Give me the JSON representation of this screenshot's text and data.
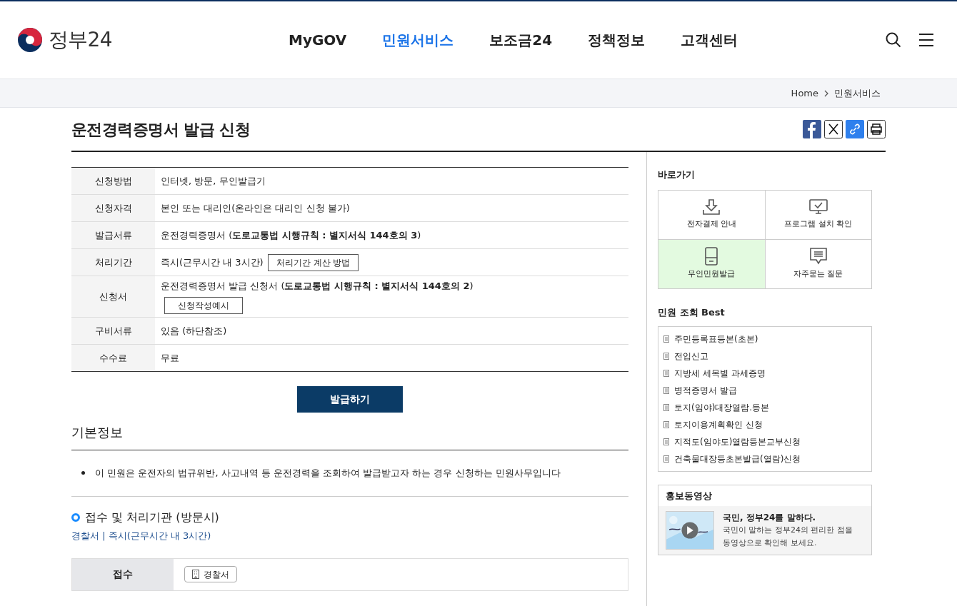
{
  "header": {
    "logo_text": "정부24",
    "nav": [
      {
        "label": "MyGOV",
        "selected": false
      },
      {
        "label": "민원서비스",
        "selected": true
      },
      {
        "label": "보조금24",
        "selected": false
      },
      {
        "label": "정책정보",
        "selected": false
      },
      {
        "label": "고객센터",
        "selected": false
      }
    ]
  },
  "breadcrumb": [
    "Home",
    "민원서비스"
  ],
  "page_title": "운전경력증명서 발급 신청",
  "info_table": [
    {
      "label": "신청방법",
      "value": "인터넷, 방문, 무인발급기"
    },
    {
      "label": "신청자격",
      "value": "본인 또는 대리인(온라인은 대리인 신청 불가)"
    },
    {
      "label": "발급서류",
      "value": "운전경력증명서 (**도로교통법 시행규칙 : 별지서식 144호의 3**)"
    },
    {
      "label": "처리기간",
      "value": "즉시(근무시간 내 3시간)",
      "button": "처리기간 계산 방법",
      "button_below": false
    },
    {
      "label": "신청서",
      "value": "운전경력증명서 발급 신청서 (**도로교통법 시행규칙 : 별지서식 144호의 2**)",
      "button": "신청작성예시",
      "button_below": true
    },
    {
      "label": "구비서류",
      "value": "있음 (하단참조)"
    },
    {
      "label": "수수료",
      "value": "무료"
    }
  ],
  "apply_button": "발급하기",
  "basic_info": {
    "title": "기본정보",
    "bullets": [
      "이 민원은 운전자의 법규위반, 사고내역 등 운전경력을 조회하여 발급받고자 하는 경우 신청하는 민원사무입니다"
    ]
  },
  "agency": {
    "title": "접수 및 처리기관 (방문시)",
    "summary": "경찰서 | 즉시(근무시간 내 3시간)",
    "rows": [
      {
        "label": "접수",
        "office": "경찰서"
      }
    ]
  },
  "sidebar": {
    "shortcuts_title": "바로가기",
    "shortcuts": [
      {
        "kind": "download",
        "label": "전자결제 안내",
        "highlighted": false
      },
      {
        "kind": "monitor",
        "label": "프로그램 설치 확인",
        "highlighted": false
      },
      {
        "kind": "kiosk",
        "label": "무인민원발급",
        "highlighted": true
      },
      {
        "kind": "chat",
        "label": "자주묻는 질문",
        "highlighted": false
      }
    ],
    "best_title": "민원 조회 Best",
    "best": [
      "주민등록표등본(초본)",
      "전입신고",
      "지방세 세목별 과세증명",
      "병적증명서 발급",
      "토지(임야)대장열람.등본",
      "토지이용계획확인 신청",
      "지적도(임야도)열람등본교부신청",
      "건축물대장등초본발급(열람)신청"
    ],
    "video": {
      "title": "홍보동영상",
      "headline": "국민, 정부24를 말하다.",
      "description": "국민이 말하는 정부24의 편리한 점을\n동영상으로 확인해 보세요."
    }
  }
}
